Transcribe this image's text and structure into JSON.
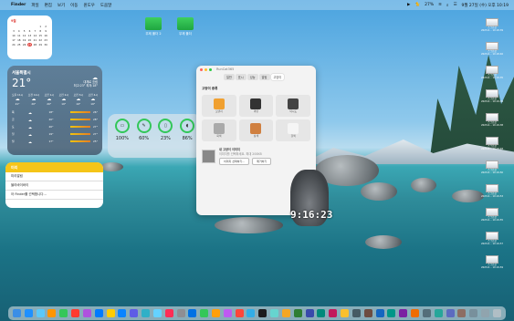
{
  "menubar": {
    "app": "Finder",
    "items": [
      "파일",
      "편집",
      "보기",
      "이동",
      "윈도우",
      "도움말"
    ],
    "status": [
      "27%",
      "9월 27일 (수) 오후 10:19"
    ]
  },
  "calendar": {
    "month": "9월",
    "days": [
      "",
      "",
      "",
      "",
      "",
      "1",
      "2",
      "3",
      "4",
      "5",
      "6",
      "7",
      "8",
      "9",
      "10",
      "11",
      "12",
      "13",
      "14",
      "15",
      "16",
      "17",
      "18",
      "19",
      "20",
      "21",
      "22",
      "23",
      "24",
      "25",
      "26",
      "27",
      "28",
      "29",
      "30"
    ],
    "today": "27"
  },
  "folders": [
    {
      "label": "무제 폴더 2"
    },
    {
      "label": "무제 폴더"
    }
  ],
  "weather": {
    "city": "서울특별시",
    "temp": "21°",
    "cond": "대체로 흐림",
    "hilo": "최고:23° 최저:18°",
    "hours": [
      {
        "t": "오후 11시",
        "v": "21°"
      },
      {
        "t": "오전 12시",
        "v": "20°"
      },
      {
        "t": "오전 1시",
        "v": "20°"
      },
      {
        "t": "오전 2시",
        "v": "19°"
      },
      {
        "t": "오전 3시",
        "v": "19°"
      },
      {
        "t": "오전 4시",
        "v": "19°"
      }
    ],
    "days": [
      {
        "d": "목",
        "lo": "18°",
        "hi": "26°"
      },
      {
        "d": "금",
        "lo": "20°",
        "hi": "28°"
      },
      {
        "d": "토",
        "lo": "20°",
        "hi": "27°"
      },
      {
        "d": "일",
        "lo": "19°",
        "hi": "27°"
      },
      {
        "d": "월",
        "lo": "17°",
        "hi": "25°"
      }
    ]
  },
  "battery": [
    {
      "pct": "100%",
      "icon": "laptop-icon"
    },
    {
      "pct": "60%",
      "icon": "pencil-icon"
    },
    {
      "pct": "23%",
      "icon": "iphone-icon"
    },
    {
      "pct": "86%",
      "icon": "airpods-icon"
    }
  ],
  "notes": {
    "header": "미리",
    "items": [
      "미리알림",
      "블라바이바이",
      "아 Finder를 선택합니다..."
    ]
  },
  "window": {
    "title": "RunCat365",
    "tabs": [
      "일반",
      "표시",
      "성능",
      "알림",
      "고양이"
    ],
    "section": "고양이 종류",
    "cats": [
      {
        "name": "오렌지",
        "color": "#f0a030"
      },
      {
        "name": "까만",
        "color": "#333"
      },
      {
        "name": "턱시도",
        "color": "#444"
      },
      {
        "name": "회색",
        "color": "#aaa"
      },
      {
        "name": "삼색",
        "color": "#d08040"
      },
      {
        "name": "흰색",
        "color": "#f5f5f5"
      }
    ],
    "mycat": {
      "title": "내 고양이 이미지",
      "desc": "이미지를 선택하세요. 최대 200KB",
      "btn1": "이미지 선택하기...",
      "btn2": "제거하기"
    }
  },
  "clock": "9:16:23",
  "screenshots": [
    {
      "l1": "스크린샷",
      "l2": "2023-0... 10.18.39"
    },
    {
      "l1": "스크린샷",
      "l2": "2023-0... 10.18.46"
    },
    {
      "l1": "스크린샷",
      "l2": "2023-0... 10.19.35"
    },
    {
      "l1": "스크린샷",
      "l2": "2023-0... 10.19.39"
    },
    {
      "l1": "스크린샷",
      "l2": "2023-0... 10.19.38"
    },
    {
      "l1": "스크린샷",
      "l2": "2023-0... 10.19.48"
    },
    {
      "l1": "스크린샷",
      "l2": "2023-0... 10.19.50"
    },
    {
      "l1": "스크린샷",
      "l2": "2023-0... 10.19.53"
    },
    {
      "l1": "스크린샷",
      "l2": "2023-0... 10.19.55"
    },
    {
      "l1": "스크린샷",
      "l2": "2023-0... 10.19.57"
    },
    {
      "l1": "스크린샷",
      "l2": "2023-0... 10.19.59"
    }
  ],
  "dock": [
    "#3a8ee6",
    "#1e90ff",
    "#5ac8fa",
    "#ff9500",
    "#34c759",
    "#ff3b30",
    "#af52de",
    "#007aff",
    "#ffcc00",
    "#0a84ff",
    "#5e5ce6",
    "#30b0c7",
    "#64d2ff",
    "#ff2d55",
    "#8e8e93",
    "#0071e3",
    "#34c759",
    "#ff9f0a",
    "#bf5af2",
    "#ff453a",
    "#32ade6",
    "#1c1c1e",
    "#66d4cf",
    "#f5a623",
    "#2e7d32",
    "#3949ab",
    "#00897b",
    "#c2185b",
    "#fbc02d",
    "#455a64",
    "#6d4c41",
    "#1565c0",
    "#009688",
    "#7b1fa2",
    "#ef6c00",
    "#546e7a",
    "#26a69a",
    "#5c6bc0",
    "#8d6e63",
    "#78909c",
    "#90a4ae",
    "#b0bec5"
  ]
}
